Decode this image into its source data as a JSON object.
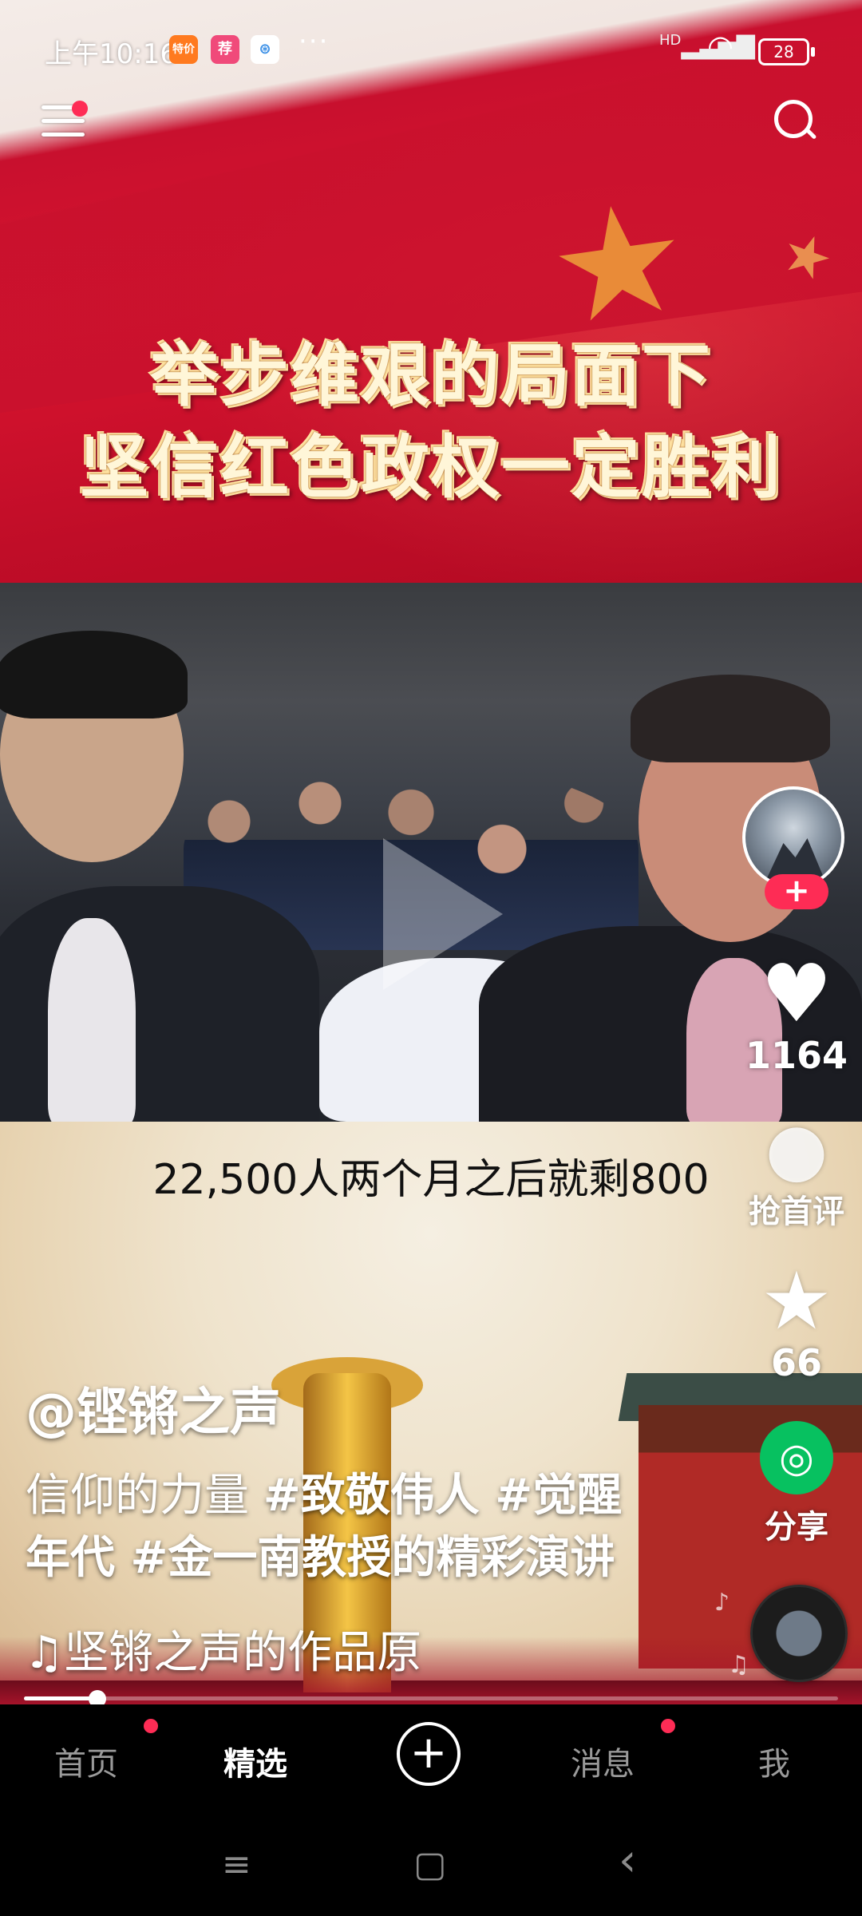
{
  "status_bar": {
    "time": "上午10:16",
    "app_icons": [
      {
        "name": "taobao-special-icon",
        "label": "特价",
        "color": "#ff7a1f"
      },
      {
        "name": "app-icon-recommend",
        "label": "荐",
        "color": "#f04a7a"
      },
      {
        "name": "app-icon-blue",
        "label": "⊛",
        "color": "#3a8fe6"
      }
    ],
    "more": "···",
    "signal": "HD",
    "battery": "28"
  },
  "video": {
    "banner_line1": "举步维艰的局面下",
    "banner_line2": "坚信红色政权一定胜利",
    "subtitle": "22,500人两个月之后就剩800"
  },
  "actions": {
    "likes": "1164",
    "comment_label": "抢首评",
    "favorites": "66",
    "share_label": "分享",
    "follow_label": "+"
  },
  "caption": {
    "author": "@铿锵之声",
    "desc_text": "信仰的力量 ",
    "tag1": "#致敬伟人 #觉醒",
    "tag2": "年代 #金一南教授的精彩演讲",
    "music": "♫坚锵之声的作品原"
  },
  "progress": {
    "fraction": 0.09
  },
  "nav": {
    "home": "首页",
    "featured": "精选",
    "add": "+",
    "messages": "消息",
    "me": "我"
  },
  "system_nav": {
    "menu": "≡",
    "home": "▢",
    "back": "‹"
  },
  "colors": {
    "accent": "#fe2c55",
    "wechat": "#07c160",
    "flag_red": "#c8102e"
  }
}
